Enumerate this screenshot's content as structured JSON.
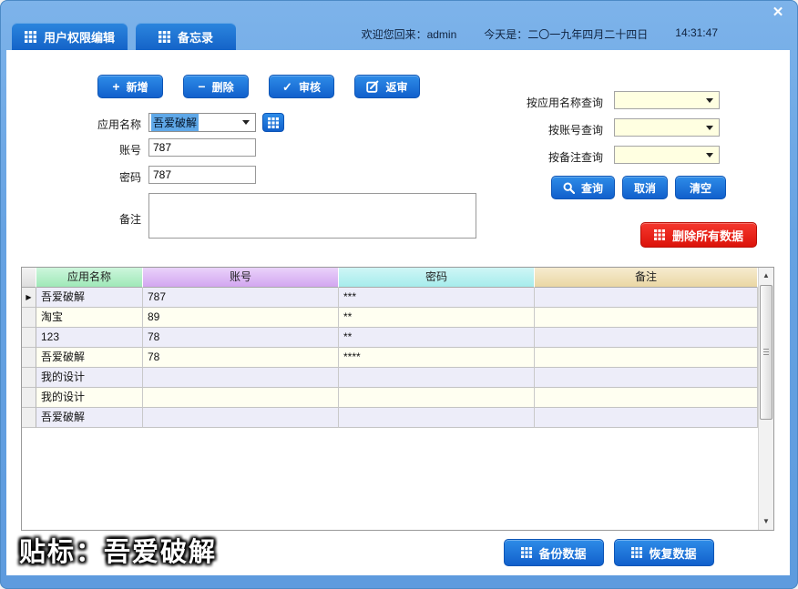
{
  "window": {
    "close": "✕"
  },
  "titlebar": {
    "tabs": [
      {
        "label": "用户权限编辑"
      },
      {
        "label": "备忘录"
      }
    ],
    "welcome": "欢迎您回来：admin",
    "date": "今天是：二〇一九年四月二十四日",
    "time": "14:31:47"
  },
  "toolbar": {
    "add": "新增",
    "remove": "删除",
    "audit": "审核",
    "reaudit": "返审"
  },
  "form": {
    "app_name": {
      "label": "应用名称",
      "value": "吾爱破解"
    },
    "account": {
      "label": "账号",
      "value": "787"
    },
    "password": {
      "label": "密码",
      "value": "787"
    },
    "remark": {
      "label": "备注",
      "value": ""
    }
  },
  "query": {
    "by_app_name_label": "按应用名称查询",
    "by_account_label": "按账号查询",
    "by_remark_label": "按备注查询",
    "by_app_name_value": "",
    "by_account_value": "",
    "by_remark_value": "",
    "search": "查询",
    "cancel": "取消",
    "clear": "清空",
    "delete_all": "删除所有数据"
  },
  "table": {
    "columns": [
      "应用名称",
      "账号",
      "密码",
      "备注"
    ],
    "rows": [
      {
        "app": "吾爱破解",
        "account": "787",
        "password": "***",
        "remark": "",
        "selected": true
      },
      {
        "app": "淘宝",
        "account": "89",
        "password": "**",
        "remark": "",
        "selected": false
      },
      {
        "app": "123",
        "account": "78",
        "password": "**",
        "remark": "",
        "selected": false
      },
      {
        "app": "吾爱破解",
        "account": "78",
        "password": "****",
        "remark": "",
        "selected": false
      },
      {
        "app": "我的设计",
        "account": "",
        "password": "",
        "remark": "",
        "selected": false
      },
      {
        "app": "我的设计",
        "account": "",
        "password": "",
        "remark": "",
        "selected": false
      },
      {
        "app": "吾爱破解",
        "account": "",
        "password": "",
        "remark": "",
        "selected": false
      }
    ]
  },
  "footer": {
    "watermark": "贴标：吾爱破解",
    "backup": "备份数据",
    "restore": "恢复数据"
  },
  "colors": {
    "frame_blue": "#66A2E2",
    "accent_blue": "#1463C8",
    "danger_red": "#DC130A",
    "header_app_green": "#9FE8B8",
    "header_account_purple": "#D2A6F0",
    "header_password_cyan": "#A6ECEC",
    "header_remark_wheat": "#EAD7A4",
    "row_odd": "#EDEDF9",
    "row_even": "#FFFFF1",
    "combo_yellow": "#FFFFE1"
  }
}
